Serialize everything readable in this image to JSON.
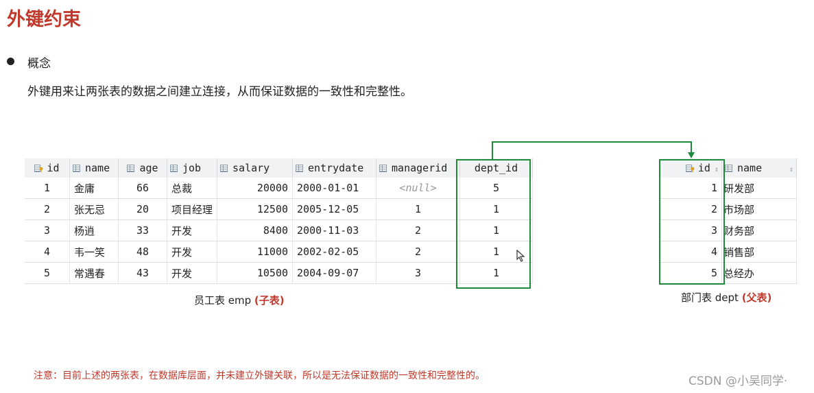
{
  "title": "外键约束",
  "concept": {
    "label": "概念",
    "description": "外键用来让两张表的数据之间建立连接，从而保证数据的一致性和完整性。"
  },
  "emp_table": {
    "columns": [
      "id",
      "name",
      "age",
      "job",
      "salary",
      "entrydate",
      "managerid",
      "dept_id"
    ],
    "rows": [
      [
        "1",
        "金庸",
        "66",
        "总裁",
        "20000",
        "2000-01-01",
        "<null>",
        "5"
      ],
      [
        "2",
        "张无忌",
        "20",
        "项目经理",
        "12500",
        "2005-12-05",
        "1",
        "1"
      ],
      [
        "3",
        "杨逍",
        "33",
        "开发",
        "8400",
        "2000-11-03",
        "2",
        "1"
      ],
      [
        "4",
        "韦一笑",
        "48",
        "开发",
        "11000",
        "2002-02-05",
        "2",
        "1"
      ],
      [
        "5",
        "常遇春",
        "43",
        "开发",
        "10500",
        "2004-09-07",
        "3",
        "1"
      ]
    ],
    "caption_main": "员工表 emp ",
    "caption_tag": "(子表)"
  },
  "dept_table": {
    "columns": [
      "id",
      "name"
    ],
    "rows": [
      [
        "1",
        "研发部"
      ],
      [
        "2",
        "市场部"
      ],
      [
        "3",
        "财务部"
      ],
      [
        "4",
        "销售部"
      ],
      [
        "5",
        "总经办"
      ]
    ],
    "caption_main": "部门表 dept ",
    "caption_tag": "(父表)"
  },
  "note": "注意：目前上述的两张表，在数据库层面，并未建立外键关联，所以是无法保证数据的一致性和完整性的。",
  "watermark": "CSDN @小吴同学·",
  "colors": {
    "title": "#c0392b",
    "highlight_box": "#1e8a3a",
    "header_bg": "#f1f2f4"
  }
}
